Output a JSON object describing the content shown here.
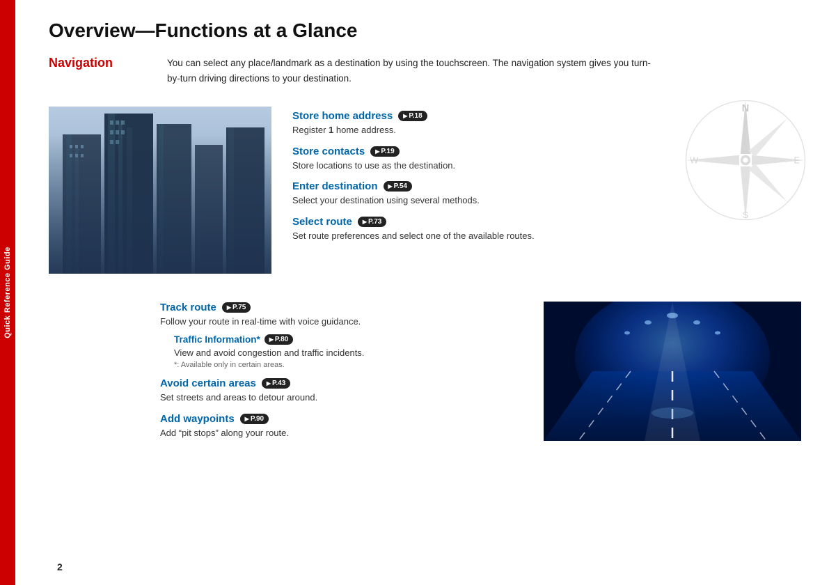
{
  "sidebar": {
    "label": "Quick Reference Guide"
  },
  "page": {
    "number": "2",
    "title": "Overview—Functions at a Glance"
  },
  "navigation": {
    "section_label": "Navigation",
    "description": "You can select any place/landmark as a destination by using the touchscreen. The navigation system gives you turn-by-turn driving directions to your destination.",
    "features": [
      {
        "title": "Store home address",
        "page_ref": "P.18",
        "description": "Register 1 home address."
      },
      {
        "title": "Store contacts",
        "page_ref": "P.19",
        "description": "Store locations to use as the destination."
      },
      {
        "title": "Enter destination",
        "page_ref": "P.54",
        "description": "Select your destination using several methods."
      },
      {
        "title": "Select route",
        "page_ref": "P.73",
        "description": "Set route preferences and select one of the available routes."
      }
    ],
    "bottom_features": [
      {
        "title": "Track route",
        "page_ref": "P.75",
        "description": "Follow your route in real-time with voice guidance.",
        "sub": {
          "title": "Traffic Information*",
          "page_ref": "P.80",
          "description": "View and avoid congestion and traffic incidents.",
          "note": "*: Available only in certain areas."
        }
      },
      {
        "title": "Avoid certain areas",
        "page_ref": "P.43",
        "description": "Set streets and areas to detour around."
      },
      {
        "title": "Add waypoints",
        "page_ref": "P.90",
        "description": "Add “pit stops” along your route."
      }
    ]
  }
}
